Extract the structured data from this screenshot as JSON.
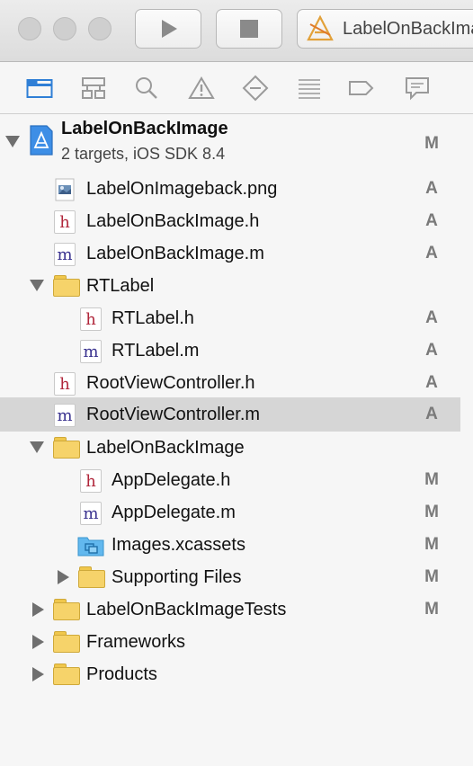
{
  "toolbar": {
    "scheme_label": "LabelOnBackImage",
    "run_icon": "play-icon",
    "stop_icon": "stop-icon"
  },
  "navigator_tabs": [
    {
      "icon": "folder-icon",
      "selected": true
    },
    {
      "icon": "hierarchy-icon"
    },
    {
      "icon": "search-icon"
    },
    {
      "icon": "warning-icon"
    },
    {
      "icon": "diamond-icon"
    },
    {
      "icon": "list-icon"
    },
    {
      "icon": "tag-icon"
    },
    {
      "icon": "chat-icon"
    }
  ],
  "project": {
    "name": "LabelOnBackImage",
    "subtitle": "2 targets, iOS SDK 8.4",
    "badge": "M"
  },
  "files": [
    {
      "name": "LabelOnImageback.png",
      "type": "png",
      "badge": "A"
    },
    {
      "name": "LabelOnBackImage.h",
      "type": "h",
      "badge": "A"
    },
    {
      "name": "LabelOnBackImage.m",
      "type": "m",
      "badge": "A"
    },
    {
      "name": "RTLabel",
      "type": "folder",
      "badge": ""
    },
    {
      "name": "RTLabel.h",
      "type": "h",
      "badge": "A"
    },
    {
      "name": "RTLabel.m",
      "type": "m",
      "badge": "A"
    },
    {
      "name": "RootViewController.h",
      "type": "h",
      "badge": "A"
    },
    {
      "name": "RootViewController.m",
      "type": "m",
      "badge": "A",
      "selected": true
    },
    {
      "name": "LabelOnBackImage",
      "type": "folder",
      "badge": ""
    },
    {
      "name": "AppDelegate.h",
      "type": "h",
      "badge": "M"
    },
    {
      "name": "AppDelegate.m",
      "type": "m",
      "badge": "M"
    },
    {
      "name": "Images.xcassets",
      "type": "xcassets",
      "badge": "M"
    },
    {
      "name": "Supporting Files",
      "type": "folder",
      "badge": "M"
    },
    {
      "name": "LabelOnBackImageTests",
      "type": "folder",
      "badge": "M"
    },
    {
      "name": "Frameworks",
      "type": "folder",
      "badge": ""
    },
    {
      "name": "Products",
      "type": "folder",
      "badge": ""
    }
  ],
  "glyphs": {
    "h": "h",
    "m": "m"
  }
}
